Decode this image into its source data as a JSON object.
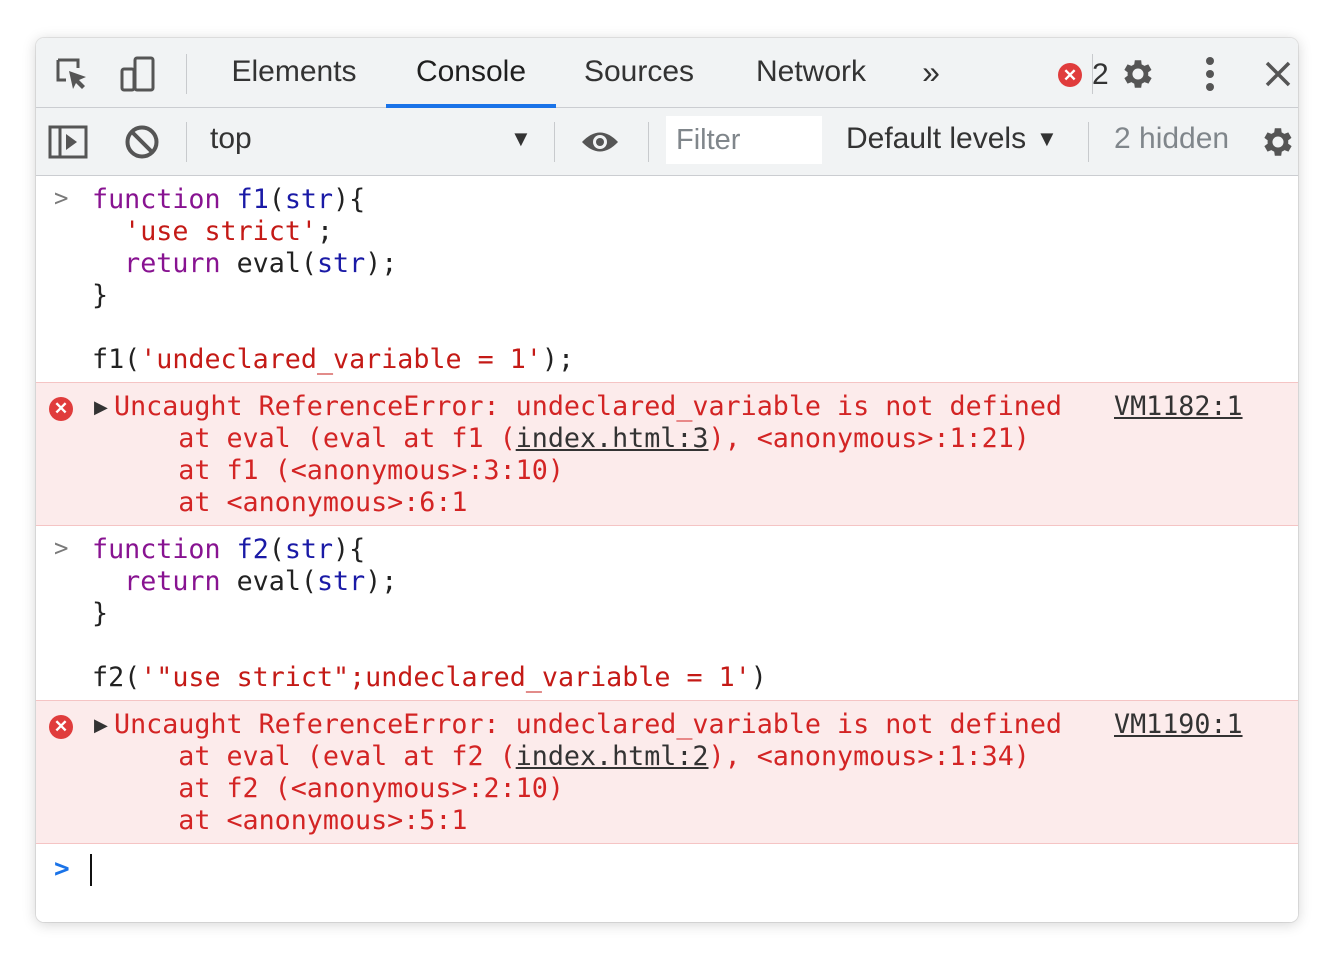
{
  "tabs": [
    {
      "label": "Elements",
      "active": false
    },
    {
      "label": "Console",
      "active": true
    },
    {
      "label": "Sources",
      "active": false
    },
    {
      "label": "Network",
      "active": false
    }
  ],
  "tab_overflow": "»",
  "error_badge": {
    "count": "2",
    "icon": "error-x-icon"
  },
  "icons": {
    "inspect": "inspect-element-icon",
    "device": "device-toolbar-icon",
    "settings": "gear-icon",
    "more": "kebab-menu-icon",
    "close": "close-icon",
    "sidebar": "show-sidebar-icon",
    "clear": "clear-console-icon",
    "eye": "live-expression-eye-icon"
  },
  "toolbar": {
    "context": "top",
    "filter_placeholder": "Filter",
    "levels": "Default levels",
    "hidden": "2 hidden"
  },
  "colors": {
    "accent": "#1a73e8",
    "error_red": "#d32424",
    "error_bg": "#fcebeb",
    "keyword": "#881391",
    "string": "#c41a16"
  },
  "entries": {
    "input1": {
      "l1_kw": "function",
      "l1_fn": "f1",
      "l1_open": "(",
      "l1_arg": "str",
      "l1_close": "){",
      "l2_str": "'use strict'",
      "l2_end": ";",
      "l3_kw": "return",
      "l3_call": " eval(",
      "l3_arg": "str",
      "l3_end": ");",
      "l4": "}",
      "l6_call": "f1(",
      "l6_str": "'undeclared_variable = 1'",
      "l6_end": ");"
    },
    "error1": {
      "message": "Uncaught ReferenceError: undeclared_variable is not defined",
      "source": "VM1182:1",
      "stack1_pre": "    at eval (eval at f1 (",
      "stack1_link": "index.html:3",
      "stack1_post": "), <anonymous>:1:21)",
      "stack2": "    at f1 (<anonymous>:3:10)",
      "stack3": "    at <anonymous>:6:1"
    },
    "input2": {
      "l1_kw": "function",
      "l1_fn": "f2",
      "l1_open": "(",
      "l1_arg": "str",
      "l1_close": "){",
      "l2_kw": "return",
      "l2_call": " eval(",
      "l2_arg": "str",
      "l2_end": ");",
      "l3": "}",
      "l5_call": "f2(",
      "l5_str": "'\"use strict\";undeclared_variable = 1'",
      "l5_end": ")"
    },
    "error2": {
      "message": "Uncaught ReferenceError: undeclared_variable is not defined",
      "source": "VM1190:1",
      "stack1_pre": "    at eval (eval at f2 (",
      "stack1_link": "index.html:2",
      "stack1_post": "), <anonymous>:1:34)",
      "stack2": "    at f2 (<anonymous>:2:10)",
      "stack3": "    at <anonymous>:5:1"
    }
  },
  "prompt_glyph": ">",
  "expand_glyph": "▶",
  "dropdown_glyph": "▼"
}
